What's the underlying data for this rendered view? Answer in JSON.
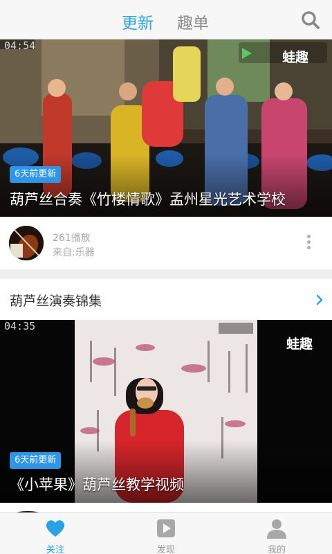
{
  "header": {
    "tabs": [
      {
        "label": "更新",
        "active": true
      },
      {
        "label": "趣单",
        "active": false
      }
    ],
    "search_icon": "search-icon"
  },
  "feed": {
    "video1": {
      "duration": "04:54",
      "watermark": "蛙趣",
      "badge": "6天前更新",
      "title": "葫芦丝合奏《竹楼情歌》孟州星光艺术学校"
    },
    "meta": {
      "plays": "261播放",
      "source": "来自:乐器"
    },
    "section_title": "葫芦丝演奏锦集",
    "video2": {
      "duration": "04:35",
      "watermark": "蛙趣",
      "badge": "6天前更新",
      "title": "《小苹果》葫芦丝教学视频"
    }
  },
  "bottom_nav": {
    "items": [
      {
        "label": "关注",
        "icon": "heart-icon",
        "active": true
      },
      {
        "label": "发现",
        "icon": "play-icon",
        "active": false
      },
      {
        "label": "我的",
        "icon": "person-icon",
        "active": false
      }
    ]
  },
  "colors": {
    "accent": "#2aa3e4",
    "badge": "#2e95e8",
    "inactive": "#9a9a9a"
  }
}
